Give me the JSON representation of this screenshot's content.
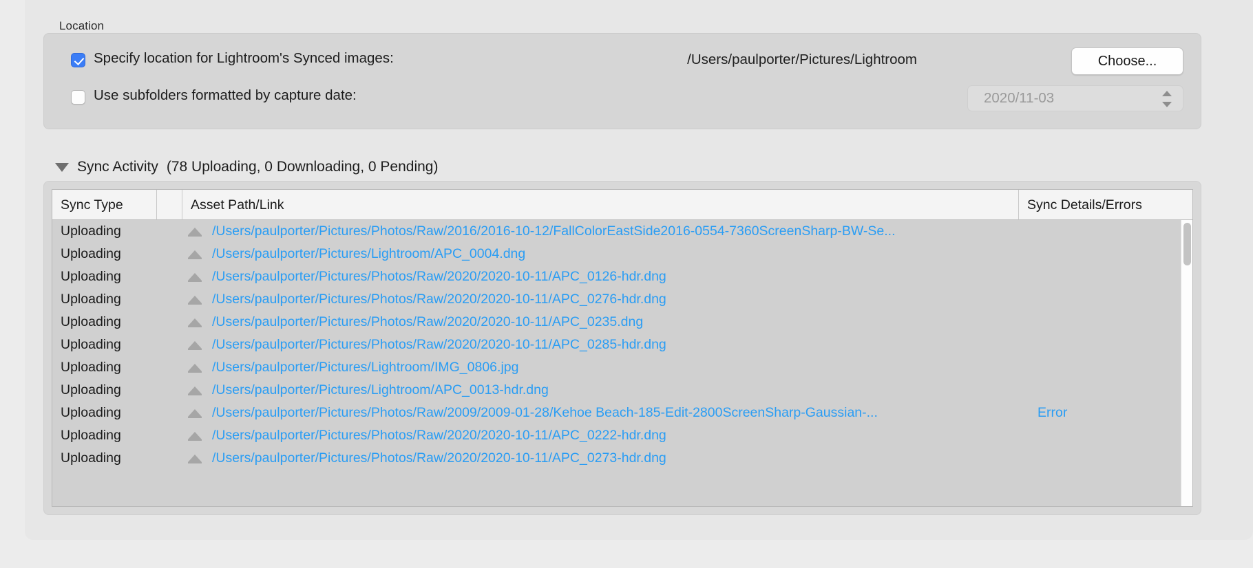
{
  "location": {
    "section_label": "Location",
    "specify_checkbox": {
      "label": "Specify location for Lightroom's Synced images:",
      "checked": true
    },
    "path_value": "/Users/paulporter/Pictures/Lightroom",
    "choose_button": "Choose...",
    "subfolder_checkbox": {
      "label": "Use subfolders formatted by capture date:",
      "checked": false
    },
    "date_format_value": "2020/11-03"
  },
  "sync_activity": {
    "title": "Sync Activity",
    "counts": "(78 Uploading, 0 Downloading, 0 Pending)",
    "disclosure_state": "expanded",
    "columns": [
      "Sync Type",
      "",
      "Asset Path/Link",
      "Sync Details/Errors"
    ],
    "rows": [
      {
        "type": "Uploading",
        "icon": "upload-triangle-icon",
        "path": "/Users/paulporter/Pictures/Photos/Raw/2016/2016-10-12/FallColorEastSide2016-0554-7360ScreenSharp-BW-Se...",
        "detail": ""
      },
      {
        "type": "Uploading",
        "icon": "upload-triangle-icon",
        "path": "/Users/paulporter/Pictures/Lightroom/APC_0004.dng",
        "detail": ""
      },
      {
        "type": "Uploading",
        "icon": "upload-triangle-icon",
        "path": "/Users/paulporter/Pictures/Photos/Raw/2020/2020-10-11/APC_0126-hdr.dng",
        "detail": ""
      },
      {
        "type": "Uploading",
        "icon": "upload-triangle-icon",
        "path": "/Users/paulporter/Pictures/Photos/Raw/2020/2020-10-11/APC_0276-hdr.dng",
        "detail": ""
      },
      {
        "type": "Uploading",
        "icon": "upload-triangle-icon",
        "path": "/Users/paulporter/Pictures/Photos/Raw/2020/2020-10-11/APC_0235.dng",
        "detail": ""
      },
      {
        "type": "Uploading",
        "icon": "upload-triangle-icon",
        "path": "/Users/paulporter/Pictures/Photos/Raw/2020/2020-10-11/APC_0285-hdr.dng",
        "detail": ""
      },
      {
        "type": "Uploading",
        "icon": "upload-triangle-icon",
        "path": "/Users/paulporter/Pictures/Lightroom/IMG_0806.jpg",
        "detail": ""
      },
      {
        "type": "Uploading",
        "icon": "upload-triangle-icon",
        "path": "/Users/paulporter/Pictures/Lightroom/APC_0013-hdr.dng",
        "detail": ""
      },
      {
        "type": "Uploading",
        "icon": "upload-triangle-icon",
        "path": "/Users/paulporter/Pictures/Photos/Raw/2009/2009-01-28/Kehoe Beach-185-Edit-2800ScreenSharp-Gaussian-...",
        "detail": "Error"
      },
      {
        "type": "Uploading",
        "icon": "upload-triangle-icon",
        "path": "/Users/paulporter/Pictures/Photos/Raw/2020/2020-10-11/APC_0222-hdr.dng",
        "detail": ""
      },
      {
        "type": "Uploading",
        "icon": "upload-triangle-icon",
        "path": "/Users/paulporter/Pictures/Photos/Raw/2020/2020-10-11/APC_0273-hdr.dng",
        "detail": ""
      }
    ]
  },
  "colors": {
    "link_blue": "#2a9df4",
    "checkbox_blue": "#3b7df6",
    "panel_gray": "#d6d6d6",
    "table_gray": "#d0d0d0",
    "header_gray": "#f4f4f4"
  }
}
